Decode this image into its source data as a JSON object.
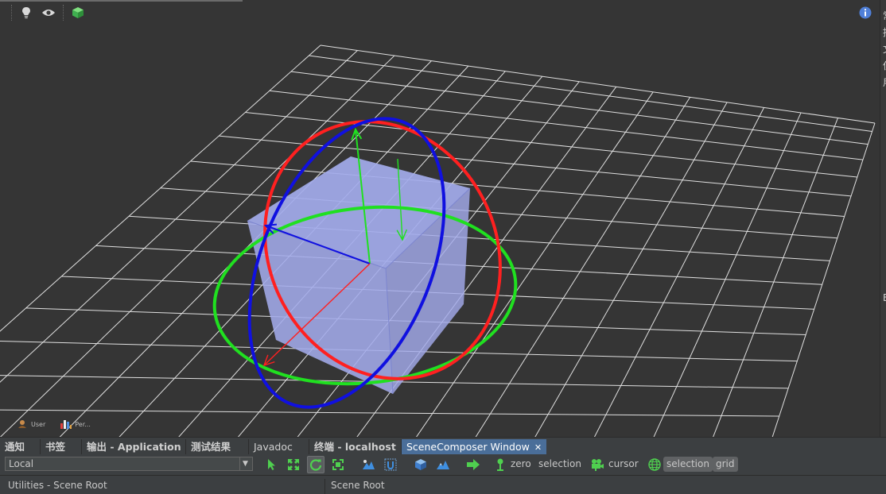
{
  "viewport": {
    "toolbar_icons": [
      "lightbulb-icon",
      "eye-icon",
      "cube-icon"
    ],
    "info_icon": "info-icon",
    "colors": {
      "background": "#353535",
      "grid": "#e0e0e0",
      "cube": "#a3abeb",
      "x_axis": "#ff2020",
      "y_axis": "#20e020",
      "z_axis": "#1010e0"
    }
  },
  "right_strip": {
    "glyphs": [
      "常",
      "拖",
      "文",
      "使",
      "用",
      "B"
    ]
  },
  "status": {
    "items": [
      {
        "label": "User",
        "icon": "user-icon"
      },
      {
        "label": "Per...",
        "icon": "performance-icon"
      }
    ]
  },
  "tabs": [
    {
      "label": "通知"
    },
    {
      "label": "书签"
    },
    {
      "label": "输出 - Application"
    },
    {
      "label": "测试结果"
    },
    {
      "label": "Javadoc"
    },
    {
      "label": "终端 - localhost"
    },
    {
      "label": "SceneComposer Window",
      "active": true,
      "close": "✕"
    }
  ],
  "composer_toolbar": {
    "mode_select": "Local",
    "labels": {
      "zero": "zero",
      "selection": "selection",
      "cursor": "cursor",
      "selection_toggle": "selection",
      "grid_toggle": "grid"
    }
  },
  "panels": {
    "left_title": "Utilities - Scene Root",
    "right_title": "Scene Root"
  }
}
